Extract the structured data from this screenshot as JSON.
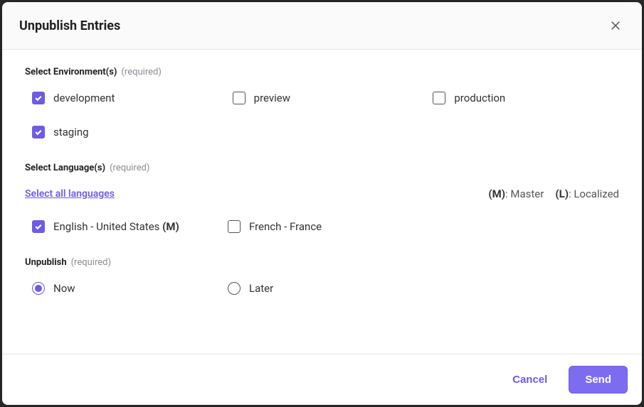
{
  "modal": {
    "title": "Unpublish Entries"
  },
  "sections": {
    "environments": {
      "title": "Select Environment(s)",
      "required_label": "(required)",
      "items": [
        {
          "label": "development",
          "checked": true
        },
        {
          "label": "preview",
          "checked": false
        },
        {
          "label": "production",
          "checked": false
        },
        {
          "label": "staging",
          "checked": true
        }
      ]
    },
    "languages": {
      "title": "Select Language(s)",
      "required_label": "(required)",
      "select_all": "Select all languages",
      "legend": {
        "master_key": "(M)",
        "master_label": ": Master",
        "localized_key": "(L)",
        "localized_label": ": Localized"
      },
      "items": [
        {
          "label": "English - United States",
          "suffix": "(M)",
          "checked": true
        },
        {
          "label": "French - France",
          "suffix": "",
          "checked": false
        }
      ]
    },
    "timing": {
      "title": "Unpublish",
      "required_label": "(required)",
      "options": [
        {
          "label": "Now",
          "selected": true
        },
        {
          "label": "Later",
          "selected": false
        }
      ]
    }
  },
  "footer": {
    "cancel": "Cancel",
    "send": "Send"
  }
}
